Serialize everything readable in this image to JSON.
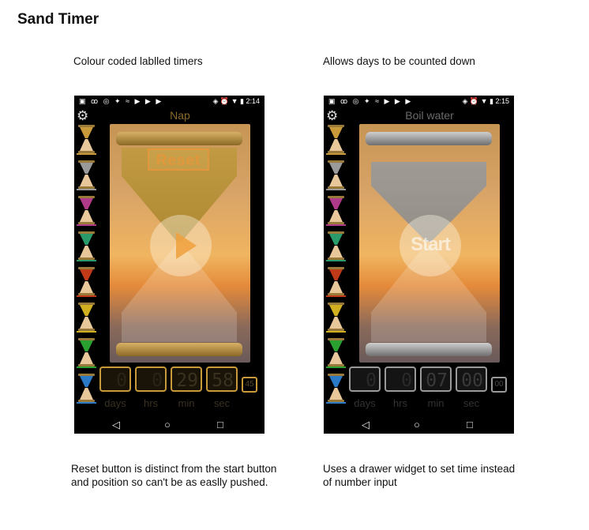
{
  "page_title": "Sand Timer",
  "captions": {
    "left_top": "Colour coded lablled timers",
    "right_top": "Allows days to be counted down",
    "left_bottom_1": "Reset button is distinct from the start button",
    "left_bottom_2": "and position so can't be as easlly pushed.",
    "right_bottom_1": "Uses a drawer widget to set time instead",
    "right_bottom_2": "of number input"
  },
  "phones": [
    {
      "status_icons": "▣ ꝏ ◎ ✦ ≈ ▶ ▶ ▶",
      "status_right": "◈ ⏰ ▼ ▮ 2:14",
      "clock": "2:14",
      "timer_name": "Nap",
      "accent": "#c89a3a",
      "reset_label": "Reset",
      "time": {
        "days": "0",
        "hrs": "0",
        "min": "29",
        "sec": "58",
        "extra": "45"
      },
      "units": {
        "days": "days",
        "hrs": "hrs",
        "min": "min",
        "sec": "sec"
      }
    },
    {
      "status_icons": "▣ ꝏ ◎ ✦ ≈ ▶ ▶ ▶",
      "status_right": "◈ ⏰ ▼ ▮ 2:15",
      "clock": "2:15",
      "timer_name": "Boil water",
      "accent": "#9a9a9a",
      "start_label": "Start",
      "time": {
        "days": "0",
        "hrs": "0",
        "min": "07",
        "sec": "00",
        "extra": "00"
      },
      "units": {
        "days": "days",
        "hrs": "hrs",
        "min": "min",
        "sec": "sec"
      }
    }
  ],
  "drawer_colors": [
    "#c89a3a",
    "#9a9a9a",
    "#b03a8a",
    "#2a9a6a",
    "#c03a1a",
    "#d0b020",
    "#2aa030",
    "#2a7ac8"
  ],
  "icons": {
    "settings": "gear-icon",
    "nav_back": "back-triangle-icon",
    "nav_home": "home-circle-icon",
    "nav_recents": "recents-square-icon"
  }
}
